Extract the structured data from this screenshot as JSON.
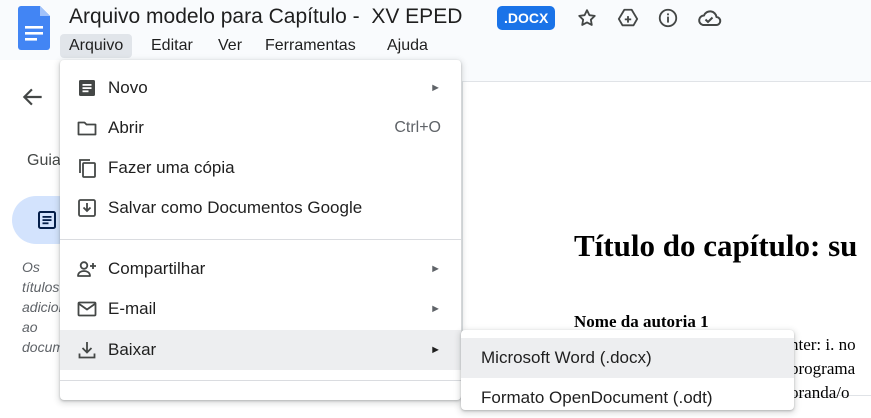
{
  "document": {
    "title": "Arquivo modelo para Capítulo -  XV EPED",
    "badge": ".DOCX"
  },
  "title_icons": [
    "star-icon",
    "move-to-drive-icon",
    "info-icon",
    "cloud-saved-icon"
  ],
  "menubar": [
    "Arquivo",
    "Editar",
    "Ver",
    "Ferramentas",
    "Ajuda"
  ],
  "sidebar": {
    "tab_label": "Guia",
    "hint": "Os títulos adicionados ao documento"
  },
  "file_menu": {
    "items": [
      {
        "label": "Novo",
        "icon": "new-document-icon",
        "submenu": true
      },
      {
        "label": "Abrir",
        "icon": "folder-icon",
        "shortcut": "Ctrl+O"
      },
      {
        "label": "Fazer uma cópia",
        "icon": "copy-icon"
      },
      {
        "label": "Salvar como Documentos Google",
        "icon": "save-as-docs-icon"
      },
      {
        "label": "Compartilhar",
        "icon": "person-add-icon",
        "submenu": true
      },
      {
        "label": "E-mail",
        "icon": "mail-icon",
        "submenu": true
      },
      {
        "label": "Baixar",
        "icon": "download-icon",
        "submenu": true
      }
    ],
    "download_submenu": [
      "Microsoft Word (.docx)",
      "Formato OpenDocument (.odt)"
    ]
  },
  "page": {
    "heading": "Título do capítulo: su",
    "author": "Nome da autoria 1",
    "body_lines": [
      "nter: i. no",
      "programa",
      "oranda/o"
    ]
  },
  "colors": {
    "accent": "#1a73e8",
    "docs_blue": "#4285f4",
    "menu_highlight": "#edeef0",
    "outline_active": "#d3e3fd"
  }
}
